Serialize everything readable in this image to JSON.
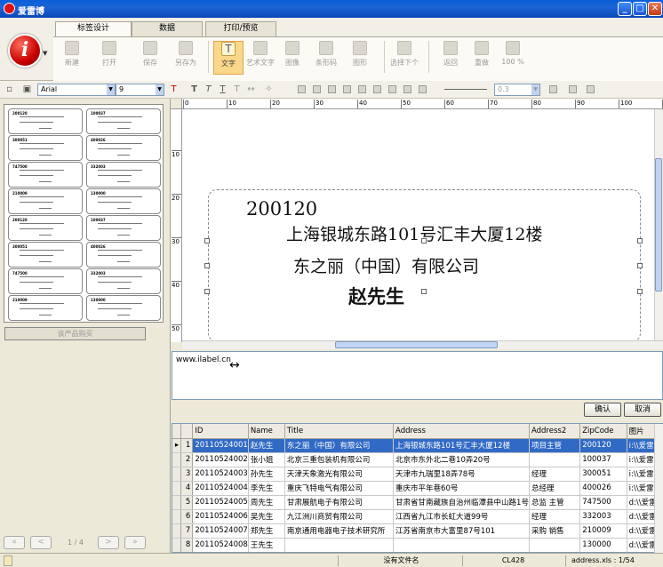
{
  "window": {
    "title": "爱雷博"
  },
  "tabs": [
    "标签设计",
    "数据",
    "打印/预览"
  ],
  "ribbon_buttons": [
    {
      "label": "新建",
      "icon": "new-icon"
    },
    {
      "label": "打开",
      "icon": "open-icon"
    },
    {
      "label": "保存",
      "icon": "save-icon"
    },
    {
      "label": "另存为",
      "icon": "save-as-icon"
    },
    {
      "label": "文字",
      "icon": "text-icon"
    },
    {
      "label": "艺术文字",
      "icon": "art-text-icon"
    },
    {
      "label": "图像",
      "icon": "image-icon"
    },
    {
      "label": "条形码",
      "icon": "barcode-icon"
    },
    {
      "label": "图形",
      "icon": "shape-icon"
    },
    {
      "label": "选择下个",
      "icon": "select-next-icon"
    },
    {
      "label": "返回",
      "icon": "undo-icon"
    },
    {
      "label": "重做",
      "icon": "redo-icon"
    },
    {
      "label": "100 %",
      "icon": "zoom-icon"
    }
  ],
  "format": {
    "font": "Arial",
    "size": "9",
    "line_width": "0.3"
  },
  "thumbnails": [
    "200120",
    "100037",
    "300051",
    "400026",
    "747500",
    "332003",
    "210009",
    "130000",
    "200120",
    "100037",
    "300051",
    "400026",
    "747500",
    "332003",
    "210009",
    "130000"
  ],
  "buy_button": "该产品购买",
  "pager": {
    "first": "«",
    "prev": "<",
    "text": "1 / 4",
    "next": ">",
    "last": "»"
  },
  "ruler": {
    "h": [
      "0",
      "10",
      "20",
      "30",
      "40",
      "50",
      "60",
      "70",
      "80",
      "90",
      "100",
      "110"
    ],
    "v": [
      "10",
      "20",
      "30",
      "40",
      "50"
    ]
  },
  "label": {
    "zip": "200120",
    "address": "上海银城东路101号汇丰大厦12楼",
    "company": "东之丽（中国）有限公司",
    "name": "赵先生"
  },
  "text_editor": {
    "value": "www.ilabel.cn"
  },
  "editor_buttons": {
    "confirm": "确认",
    "cancel": "取消"
  },
  "table": {
    "columns": [
      "ID",
      "Name",
      "Title",
      "Address",
      "Address2",
      "ZipCode",
      "图片"
    ],
    "rows": [
      [
        "1",
        "20110524001",
        "赵先生",
        "东之丽（中国）有限公司",
        "上海银城东路101号汇丰大厦12楼",
        "项目主管",
        "200120",
        "i:\\\\爱雷"
      ],
      [
        "2",
        "20110524002",
        "张小姐",
        "北京三重包装机有限公司",
        "北京市东外北二巷10弄20号",
        "",
        "100037",
        "i:\\\\爱雷"
      ],
      [
        "3",
        "20110524003",
        "孙先生",
        "天津天象激光有限公司",
        "天津市九瑞里18弄78号",
        "经理",
        "300051",
        "i:\\\\爱雷"
      ],
      [
        "4",
        "20110524004",
        "李先生",
        "重庆飞特电气有限公司",
        "重庆市平年巷60号",
        "总经理",
        "400026",
        "i:\\\\爱雷"
      ],
      [
        "5",
        "20110524005",
        "周先生",
        "甘肃展航电子有限公司",
        "甘肃省甘南藏族自治州临潭县中山路1号",
        "总监 主管",
        "747500",
        "d:\\\\爱雷"
      ],
      [
        "6",
        "20110524006",
        "吴先生",
        "九江洲川商贸有限公司",
        "江西省九江市长虹大道99号",
        "经理",
        "332003",
        "d:\\\\爱雷"
      ],
      [
        "7",
        "20110524007",
        "郑先生",
        "南京通用电器电子技术研究所",
        "江苏省南京市大富里87号101",
        "采购 销售",
        "210009",
        "d:\\\\爱雷"
      ],
      [
        "8",
        "20110524008",
        "王先生",
        "",
        "",
        "",
        "130000",
        "d:\\\\爱雷"
      ]
    ]
  },
  "status": {
    "file": "没有文件名",
    "model": "CL428",
    "data": "address.xls : 1/54"
  }
}
